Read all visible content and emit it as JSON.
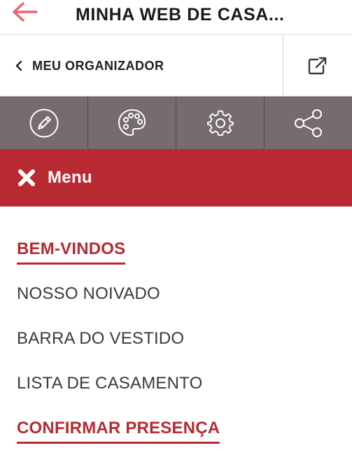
{
  "header": {
    "title": "MINHA WEB DE CASA...",
    "back_icon": "arrow-left-icon"
  },
  "organizer": {
    "label": "MEU ORGANIZADOR",
    "chevron_icon": "chevron-left-icon",
    "external_icon": "external-link-icon"
  },
  "toolbar": {
    "items": [
      {
        "icon": "pencil-icon"
      },
      {
        "icon": "palette-icon"
      },
      {
        "icon": "gear-icon"
      },
      {
        "icon": "share-icon"
      }
    ]
  },
  "menu": {
    "label": "Menu",
    "close_icon": "close-icon"
  },
  "nav": {
    "items": [
      {
        "label": "BEM-VINDOS",
        "active": true
      },
      {
        "label": "NOSSO NOIVADO",
        "active": false
      },
      {
        "label": "BARRA DO VESTIDO",
        "active": false
      },
      {
        "label": "LISTA DE CASAMENTO",
        "active": false
      },
      {
        "label": "CONFIRMAR PRESENÇA",
        "active": true
      }
    ]
  },
  "colors": {
    "accent": "#b92932",
    "toolbar": "#756b71",
    "back_arrow": "#e8666f"
  }
}
